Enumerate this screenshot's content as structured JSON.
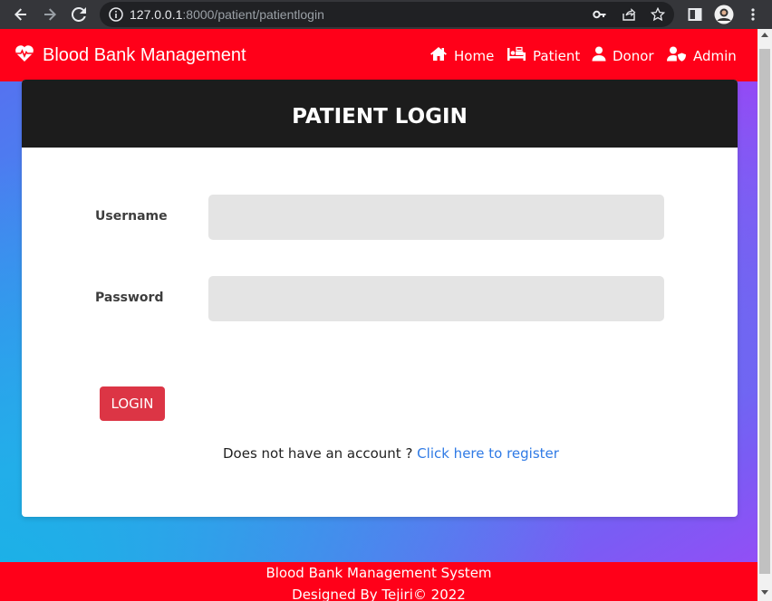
{
  "browser": {
    "url_host": "127.0.0.1",
    "url_rest": ":8000/patient/patientlogin"
  },
  "navbar": {
    "brand": "Blood Bank Management",
    "items": [
      {
        "label": "Home",
        "icon": "home-icon"
      },
      {
        "label": "Patient",
        "icon": "patient-bed-icon"
      },
      {
        "label": "Donor",
        "icon": "user-icon"
      },
      {
        "label": "Admin",
        "icon": "user-shield-icon"
      }
    ]
  },
  "login": {
    "title": "PATIENT LOGIN",
    "username_label": "Username",
    "username_value": "",
    "password_label": "Password",
    "password_value": "",
    "button_label": "LOGIN",
    "register_prompt": "Does not have an account ? ",
    "register_link": "Click here to register"
  },
  "footer": {
    "line1": "Blood Bank Management System",
    "line2": "Designed By Tejiri© 2022"
  },
  "colors": {
    "brand_red": "#ff0019",
    "header_dark": "#1c1c1c",
    "button_red": "#dc3545",
    "link_blue": "#2f7ae5"
  }
}
